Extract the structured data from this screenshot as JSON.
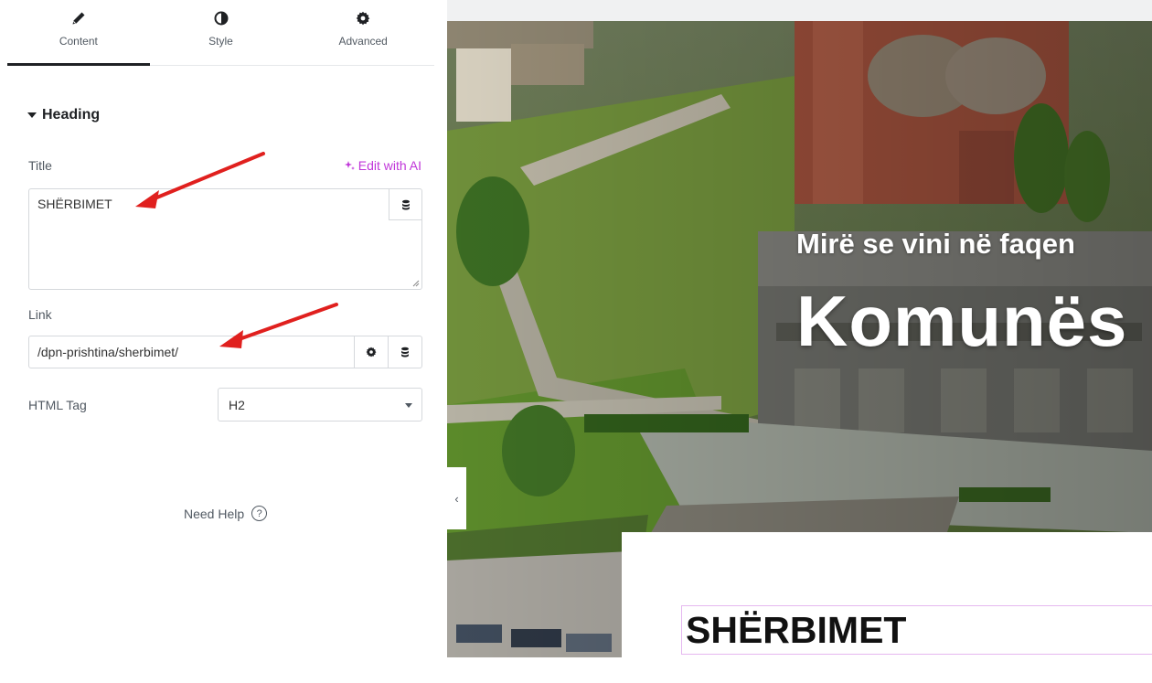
{
  "tabs": [
    {
      "label": "Content",
      "icon": "pencil-icon",
      "active": true
    },
    {
      "label": "Style",
      "icon": "half-circle-icon",
      "active": false
    },
    {
      "label": "Advanced",
      "icon": "gear-icon",
      "active": false
    }
  ],
  "section": {
    "title": "Heading"
  },
  "fields": {
    "title_label": "Title",
    "title_value": "SHËRBIMET",
    "edit_ai_label": "Edit with AI",
    "link_label": "Link",
    "link_value": "/dpn-prishtina/sherbimet/",
    "html_tag_label": "HTML Tag",
    "html_tag_value": "H2"
  },
  "help": {
    "label": "Need Help"
  },
  "colors": {
    "accent_ai": "#c036d9",
    "annotation_arrow": "#e0201e",
    "active_tab_underline": "#1f2124"
  },
  "preview": {
    "hero_subtitle": "Mirë se vini në faqen",
    "hero_title": "Komunës",
    "section_heading": "SHËRBIMET"
  }
}
